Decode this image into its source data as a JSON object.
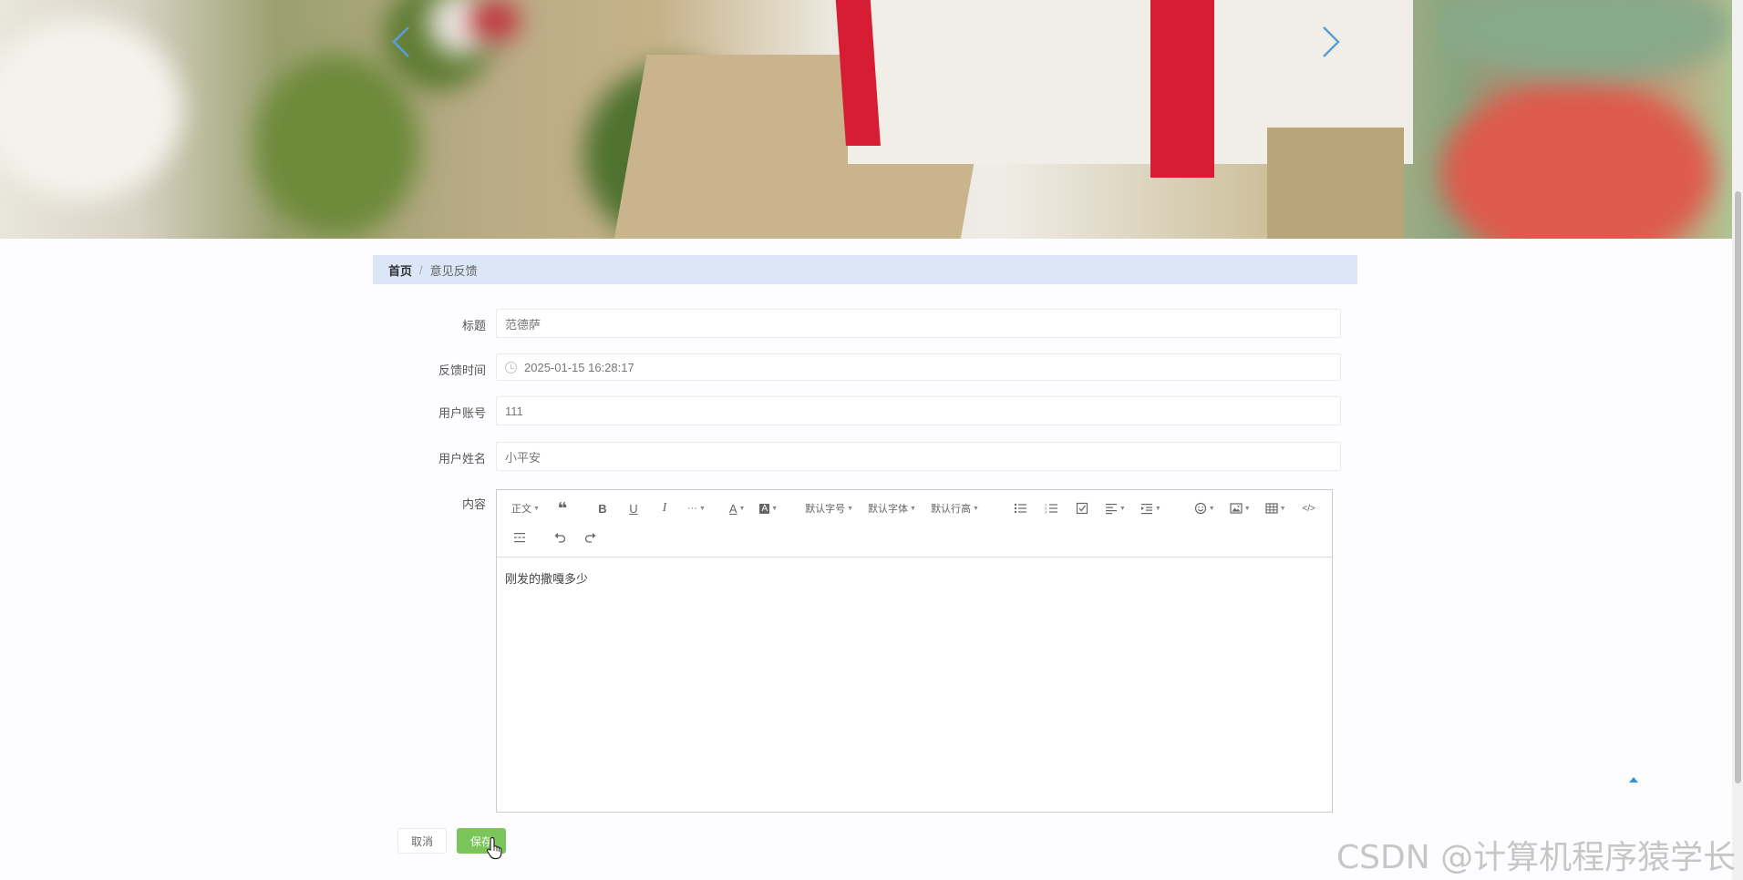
{
  "breadcrumb": {
    "home": "首页",
    "separator": "/",
    "current": "意见反馈"
  },
  "form": {
    "title_label": "标题",
    "title_value": "范德萨",
    "time_label": "反馈时间",
    "time_value": "2025-01-15 16:28:17",
    "account_label": "用户账号",
    "account_value": "111",
    "name_label": "用户姓名",
    "name_value": "小平安",
    "content_label": "内容",
    "content_value": "刚发的撒嘎多少"
  },
  "editor": {
    "heading": "正文",
    "font_size": "默认字号",
    "font_family": "默认字体",
    "line_height": "默认行高",
    "more": "···"
  },
  "buttons": {
    "cancel": "取消",
    "save": "保存"
  },
  "watermark": "CSDN @计算机程序猿学长",
  "colors": {
    "breadcrumb_bg": "#dbe6f6",
    "save_button": "#7ac65a",
    "arrow": "#5aa0d8"
  }
}
